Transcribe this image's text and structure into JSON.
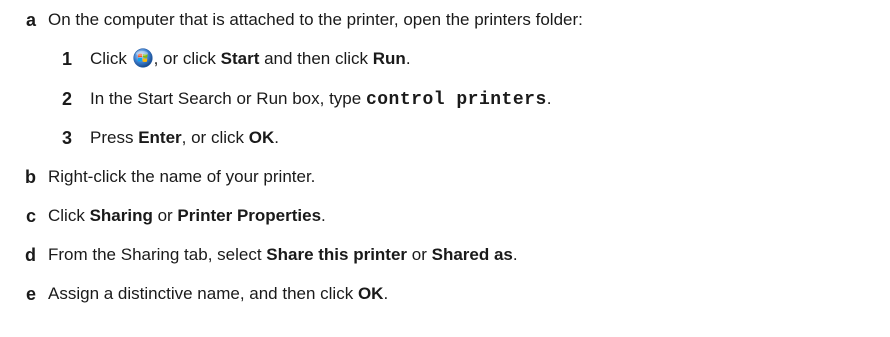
{
  "steps": [
    {
      "marker": "a",
      "text": "On the computer that is attached to the printer, open the printers folder:",
      "substeps": [
        {
          "marker": "1",
          "parts": [
            "Click ",
            "windows-start-orb-icon",
            ", or click ",
            "Start",
            " and then click ",
            "Run",
            "."
          ]
        },
        {
          "marker": "2",
          "parts": [
            "In the Start Search or Run box, type ",
            "control printers",
            "."
          ]
        },
        {
          "marker": "3",
          "parts": [
            "Press ",
            "Enter",
            ", or click ",
            "OK",
            "."
          ]
        }
      ]
    },
    {
      "marker": "b",
      "parts": [
        "Right-click the name of your printer."
      ]
    },
    {
      "marker": "c",
      "parts": [
        "Click ",
        "Sharing",
        " or ",
        "Printer Properties",
        "."
      ]
    },
    {
      "marker": "d",
      "parts": [
        "From the Sharing tab, select ",
        "Share this printer",
        " or ",
        "Shared as",
        "."
      ]
    },
    {
      "marker": "e",
      "parts": [
        "Assign a distinctive name, and then click ",
        "OK",
        "."
      ]
    }
  ],
  "icons": {
    "start_orb": "windows-start-orb-icon"
  },
  "colors": {
    "text": "#1a1a1a",
    "orb_blue": "#3b7fd1"
  }
}
